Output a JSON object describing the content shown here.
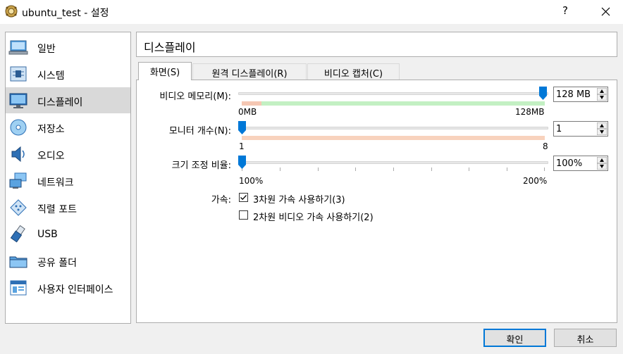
{
  "window": {
    "title": "ubuntu_test - 설정",
    "help_label": "?"
  },
  "sidebar": {
    "items": [
      {
        "label": "일반",
        "icon": "general-icon"
      },
      {
        "label": "시스템",
        "icon": "system-chip-icon"
      },
      {
        "label": "디스플레이",
        "icon": "display-monitor-icon"
      },
      {
        "label": "저장소",
        "icon": "storage-disk-icon"
      },
      {
        "label": "오디오",
        "icon": "speaker-icon"
      },
      {
        "label": "네트워크",
        "icon": "network-icon"
      },
      {
        "label": "직렬 포트",
        "icon": "serial-port-icon"
      },
      {
        "label": "USB",
        "icon": "usb-plug-icon"
      },
      {
        "label": "공유 폴더",
        "icon": "folder-icon"
      },
      {
        "label": "사용자 인터페이스",
        "icon": "user-interface-icon"
      }
    ],
    "selected": "디스플레이"
  },
  "page_title": "디스플레이",
  "tabs": [
    {
      "label": "화면(S)",
      "active": true
    },
    {
      "label": "원격 디스플레이(R)",
      "active": false
    },
    {
      "label": "비디오 캡처(C)",
      "active": false
    }
  ],
  "screen": {
    "video_memory": {
      "label": "비디오 메모리(M):",
      "value": "128 MB",
      "slider_value": 128,
      "min_label": "0MB",
      "max_label": "128MB",
      "range_colors": {
        "warn": "#f5c7b3",
        "ok": "#c3f0c3"
      }
    },
    "monitor_count": {
      "label": "모니터 개수(N):",
      "value": "1",
      "slider_value": 1,
      "min_label": "1",
      "max_label": "8",
      "range_color": "#f8d2bd"
    },
    "scale_factor": {
      "label": "크기 조정 비율:",
      "value": "100%",
      "slider_value": 100,
      "min_label": "100%",
      "max_label": "200%"
    },
    "acceleration": {
      "label": "가속:",
      "options": [
        {
          "label": "3차원 가속 사용하기(3)",
          "checked": true
        },
        {
          "label": "2차원 비디오 가속 사용하기(2)",
          "checked": false
        }
      ]
    }
  },
  "buttons": {
    "ok": "확인",
    "cancel": "취소"
  },
  "colors": {
    "accent": "#0078d7",
    "selection": "#d9d9d9"
  }
}
